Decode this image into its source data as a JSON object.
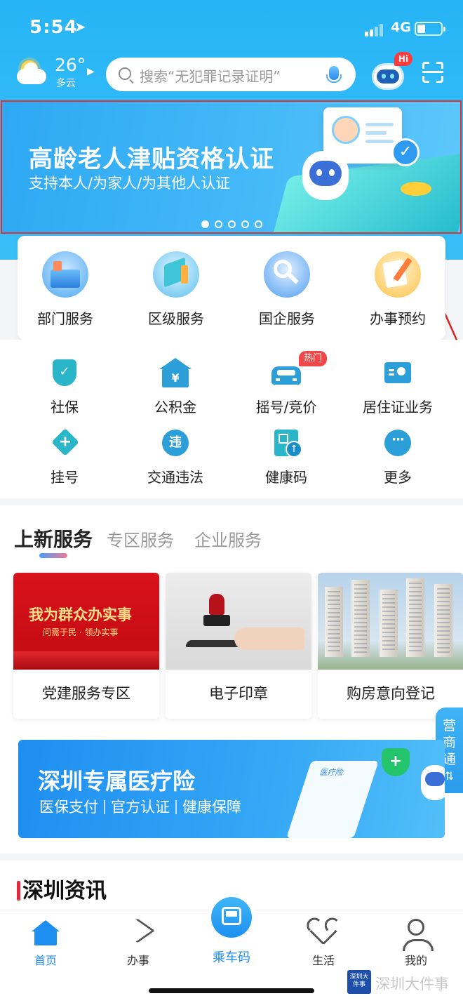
{
  "status_bar": {
    "time": "5:54",
    "location_glyph": "➤",
    "network": "4G",
    "battery_level": 0.25
  },
  "header": {
    "weather": {
      "temperature": "26°",
      "description": "多云",
      "icon": "partly-cloudy-icon"
    },
    "search": {
      "placeholder": "搜索“无犯罪记录证明”"
    },
    "assistant_badge": "Hi"
  },
  "banner": {
    "title": "高龄老人津贴资格认证",
    "subtitle": "支持本人/为家人/为其他人认证",
    "dots_total": 5,
    "active_dot": 0
  },
  "quick_services": [
    {
      "label": "部门服务",
      "icon": "department-icon"
    },
    {
      "label": "区级服务",
      "icon": "district-icon"
    },
    {
      "label": "国企服务",
      "icon": "state-enterprise-icon"
    },
    {
      "label": "办事预约",
      "icon": "appointment-icon"
    }
  ],
  "grid": [
    {
      "label": "社保",
      "icon": "shield-check-icon",
      "glyph": "✓"
    },
    {
      "label": "公积金",
      "icon": "house-fund-icon",
      "glyph": "¥"
    },
    {
      "label": "摇号/竞价",
      "icon": "car-icon",
      "badge": "热门"
    },
    {
      "label": "居住证业务",
      "icon": "id-card-icon"
    },
    {
      "label": "挂号",
      "icon": "medical-plus-icon",
      "glyph": "+"
    },
    {
      "label": "交通违法",
      "icon": "traffic-violation-icon",
      "glyph": "违"
    },
    {
      "label": "健康码",
      "icon": "health-code-icon"
    },
    {
      "label": "更多",
      "icon": "more-icon",
      "glyph": "···"
    }
  ],
  "service_tabs": [
    {
      "label": "上新服务",
      "active": true
    },
    {
      "label": "专区服务",
      "active": false
    },
    {
      "label": "企业服务",
      "active": false
    }
  ],
  "service_cards": [
    {
      "caption": "党建服务专区",
      "image_title": "我为群众办实事",
      "image_subtitle": "问需于民 · 领办实事"
    },
    {
      "caption": "电子印章"
    },
    {
      "caption": "购房意向登记"
    }
  ],
  "side_tab": {
    "label": "营商通",
    "glyph": "⇅"
  },
  "medical_banner": {
    "title": "深圳专属医疗险",
    "tags": [
      "医保支付",
      "官方认证",
      "健康保障"
    ],
    "doc_label": "医疗险"
  },
  "news": {
    "title": "深圳资讯"
  },
  "tab_bar": [
    {
      "label": "首页",
      "icon": "home-icon",
      "active": true
    },
    {
      "label": "办事",
      "icon": "send-icon",
      "active": false
    },
    {
      "label": "乘车码",
      "icon": "bus-code-icon",
      "active": false
    },
    {
      "label": "生活",
      "icon": "heart-icon",
      "active": false
    },
    {
      "label": "我的",
      "icon": "person-icon",
      "active": false
    }
  ],
  "watermark": {
    "text": "深圳大件事",
    "logo_text": "深圳大件事"
  },
  "colors": {
    "primary": "#1d8ff0",
    "header": "#2fb9f7",
    "highlight_border": "#e03030",
    "hot_badge": "#f04848"
  }
}
